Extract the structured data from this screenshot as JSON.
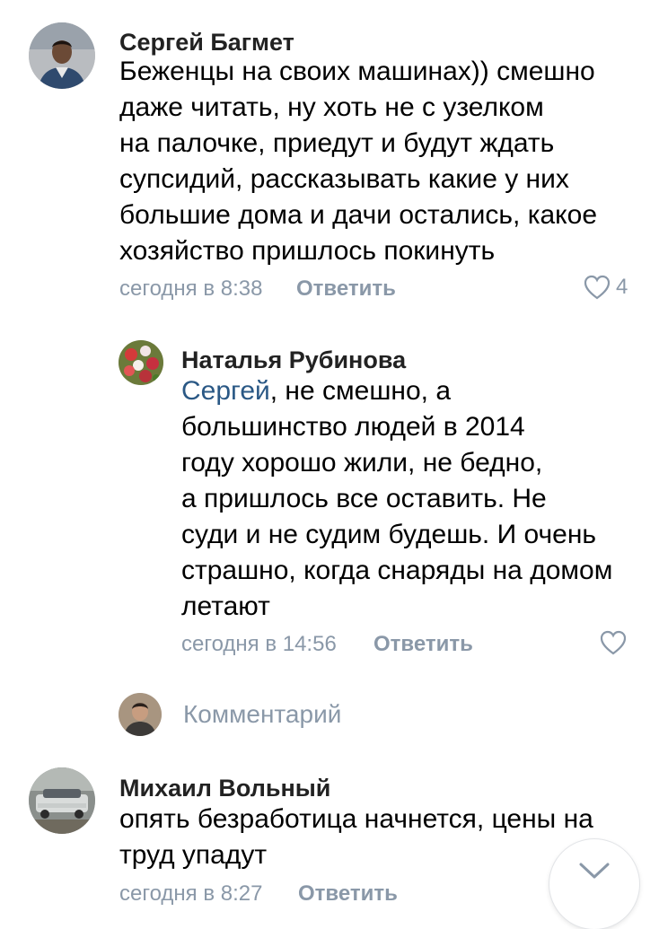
{
  "comments": [
    {
      "author": "Сергей Багмет",
      "lines": [
        "Беженцы на своих машинах)) смешно",
        "даже читать, ну хоть не с узелком",
        "на палочке, приедут и будут ждать",
        "супсидий, рассказывать какие у них",
        "большие дома и дачи остались, какое",
        "хозяйство пришлось покинуть"
      ],
      "time": "сегодня в 8:38",
      "reply_label": "Ответить",
      "likes": "4",
      "avatar_icon": "person-photo-avatar"
    },
    {
      "author": "Наталья Рубинова",
      "mention": "Сергей",
      "first_line_rest": ", не смешно, а",
      "lines": [
        "большинство людей в 2014",
        "году хорошо жили, не бедно,",
        "а пришлось все оставить. Не",
        "суди и не судим будешь. И очень",
        "страшно, когда снаряды на домом",
        "летают"
      ],
      "time": "сегодня в 14:56",
      "reply_label": "Ответить",
      "avatar_icon": "flowers-photo-avatar"
    },
    {
      "author": "Михаил Вольный",
      "lines": [
        "опять безработица начнется, цены на",
        "труд упадут"
      ],
      "time": "сегодня в 8:27",
      "reply_label": "Ответить",
      "avatar_icon": "car-photo-avatar"
    }
  ],
  "composer": {
    "placeholder": "Комментарий",
    "avatar_icon": "user-photo-avatar"
  },
  "scroll_button_icon": "chevron-down-icon",
  "colors": {
    "text": "#000000",
    "secondary": "#8a98a8",
    "mention": "#2a5885",
    "author": "#222222"
  }
}
